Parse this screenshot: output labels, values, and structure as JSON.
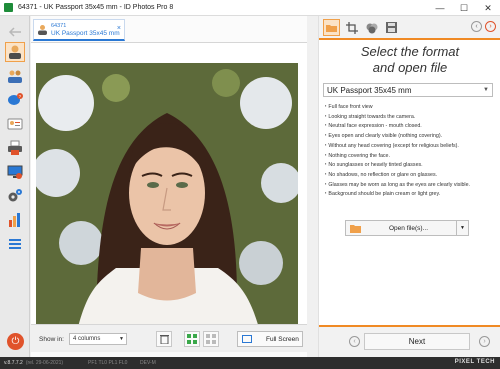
{
  "window": {
    "title": "64371 - UK Passport 35x45 mm - ID Photos Pro 8",
    "minimize_glyph": "—",
    "maximize_glyph": "☐",
    "close_glyph": "✕"
  },
  "sidebar": {
    "items": [
      {
        "icon": "back-arrow-icon"
      },
      {
        "icon": "passport-person-icon"
      },
      {
        "icon": "employees-icon"
      },
      {
        "icon": "help-chat-icon"
      },
      {
        "icon": "id-card-icon"
      },
      {
        "icon": "printer-icon"
      },
      {
        "icon": "monitor-icon"
      },
      {
        "icon": "settings-gears-icon"
      },
      {
        "icon": "statistics-icon"
      },
      {
        "icon": "list-menu-icon"
      }
    ],
    "power_glyph": "⏻"
  },
  "photo_panel": {
    "tab": {
      "id": "64371",
      "name": "UK Passport 35x45 mm",
      "close": "×"
    },
    "show_in_label": "Show in:",
    "show_in_value": "4 columns",
    "fullscreen_label": "Full Screen"
  },
  "right_panel": {
    "heading_line1": "Select the format",
    "heading_line2": "and open file",
    "format_value": "UK Passport 35x45 mm",
    "requirements": [
      "Full face front view",
      "Looking straight towards the camera.",
      "Neutral face expression - mouth closed.",
      "Eyes open and clearly visible (nothing covering).",
      "Without any head covering (except for religious beliefs).",
      "Nothing covering the face.",
      "No sunglasses or heavily tinted glasses.",
      "No shadows, no reflection or glare on glasses.",
      "Glasses may be worn as long as the eyes are clearly visible.",
      "Background should be plain cream or light grey."
    ],
    "open_button_label": "Open file(s)...",
    "next_label": "Next"
  },
  "statusbar": {
    "version": "v.8.7.7.2",
    "release": "(rel. 29-06-2021)",
    "info1": "PF1 TL0 PL1 FL0",
    "info2": "DEV-M",
    "logo": "PIXEL TECH"
  },
  "colors": {
    "accent_orange": "#f08a24",
    "accent_blue": "#2a78d4",
    "power_red": "#e0532b"
  }
}
